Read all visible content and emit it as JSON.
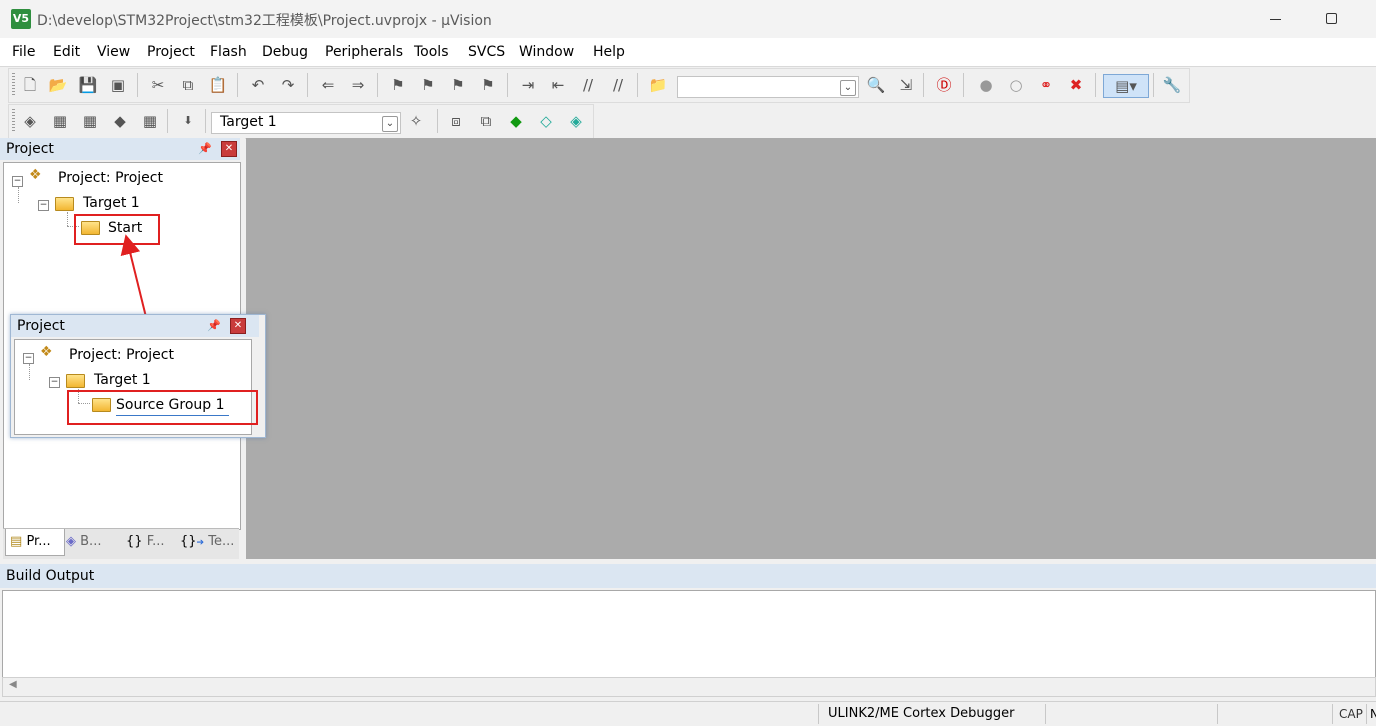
{
  "window": {
    "icon_text": "V5",
    "title": "D:\\develop\\STM32Project\\stm32工程模板\\Project.uvprojx - µVision"
  },
  "menu": [
    "File",
    "Edit",
    "View",
    "Project",
    "Flash",
    "Debug",
    "Peripherals",
    "Tools",
    "SVCS",
    "Window",
    "Help"
  ],
  "toolbar2": {
    "target_value": "Target 1"
  },
  "project_pane": {
    "title": "Project",
    "tree": {
      "root": "Project: Project",
      "target": "Target 1",
      "group": "Start"
    },
    "tabs": [
      "Pr...",
      "B...",
      "F...",
      "Te..."
    ]
  },
  "callout": {
    "title": "Project",
    "tree": {
      "root": "Project: Project",
      "target": "Target 1",
      "group": "Source Group 1"
    }
  },
  "build_output": {
    "title": "Build Output"
  },
  "status": {
    "debugger": "ULINK2/ME Cortex Debugger",
    "caps": "CAP",
    "num": "N"
  },
  "colors": {
    "highlight": "#e02020",
    "editor_bg": "#ababab"
  }
}
